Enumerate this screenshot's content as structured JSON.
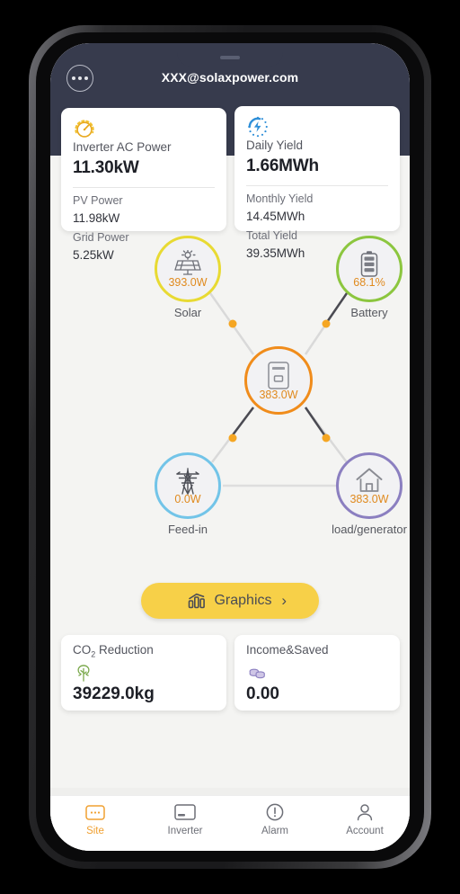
{
  "header": {
    "title": "XXX@solaxpower.com",
    "menu_icon": "ellipsis-icon"
  },
  "cards": {
    "inverter": {
      "icon": "gauge-icon",
      "main_label": "Inverter AC Power",
      "main_value": "11.30kW",
      "sub1_label": "PV Power",
      "sub1_value": "11.98kW",
      "sub2_label": "Grid Power",
      "sub2_value": "5.25kW"
    },
    "yield": {
      "icon": "energy-bolt-icon",
      "main_label": "Daily Yield",
      "main_value": "1.66MWh",
      "sub1_label": "Monthly Yield",
      "sub1_value": "14.45MWh",
      "sub2_label": "Total Yield",
      "sub2_value": "39.35MWh"
    }
  },
  "flow": {
    "solar": {
      "caption": "Solar",
      "value": "393.0W",
      "ring_color": "#e8da33",
      "icon": "solar-panel-icon"
    },
    "battery": {
      "caption": "Battery",
      "value": "68.1%",
      "ring_color": "#8cc63f",
      "icon": "battery-icon"
    },
    "inverter": {
      "caption": "",
      "value": "383.0W",
      "ring_color": "#f08c1b",
      "icon": "inverter-box-icon"
    },
    "feedin": {
      "caption": "Feed-in",
      "value": "0.0W",
      "ring_color": "#72c4e8",
      "icon": "pylon-icon"
    },
    "load": {
      "caption": "load/generator",
      "value": "383.0W",
      "ring_color": "#8b7fc0",
      "icon": "house-icon"
    },
    "value_color": "#e08a1e",
    "flow_dot_color": "#f5a623"
  },
  "graphics_button": {
    "label": "Graphics",
    "icon": "bar-chart-icon",
    "chevron": "›",
    "background": "#f7d048"
  },
  "bottom_cards": {
    "co2": {
      "label_prefix": "CO",
      "label_sub": "2",
      "label_suffix": " Reduction",
      "icon": "tree-icon",
      "value": "39229.0kg"
    },
    "income": {
      "label": "Income&Saved",
      "icon": "coins-icon",
      "value": "0.00"
    }
  },
  "tab_bar": {
    "active_color": "#f0a030",
    "items": [
      {
        "label": "Site",
        "icon": "site-icon",
        "active": true
      },
      {
        "label": "Inverter",
        "icon": "inverter-icon",
        "active": false
      },
      {
        "label": "Alarm",
        "icon": "alarm-icon",
        "active": false
      },
      {
        "label": "Account",
        "icon": "account-icon",
        "active": false
      }
    ]
  }
}
